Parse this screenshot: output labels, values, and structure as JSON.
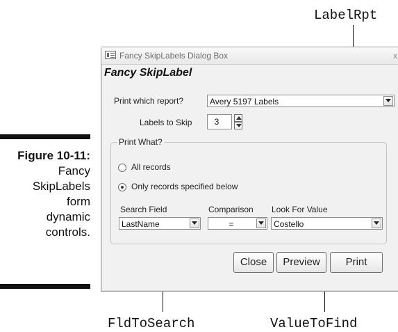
{
  "caption": {
    "figure_number": "Figure 10-11:",
    "lines": [
      "Fancy",
      "SkipLabels",
      "form",
      "dynamic",
      "controls."
    ]
  },
  "callouts": {
    "label_rpt": "LabelRpt",
    "fld_to_search": "FldToSearch",
    "value_to_find": "ValueToFind"
  },
  "window": {
    "title": "Fancy SkipLabels Dialog Box",
    "close_glyph": "x",
    "icon": "form-icon"
  },
  "form": {
    "heading": "Fancy SkipLabel",
    "print_which_report": {
      "label": "Print which report?",
      "value": "Avery 5197 Labels"
    },
    "labels_to_skip": {
      "label": "Labels to Skip",
      "value": "3"
    },
    "print_what": {
      "title": "Print What?",
      "options": [
        {
          "label": "All records",
          "selected": false
        },
        {
          "label": "Only records specified below",
          "selected": true
        }
      ]
    },
    "search_field": {
      "label": "Search Field",
      "value": "LastName"
    },
    "comparison": {
      "label": "Comparison",
      "value": "="
    },
    "look_for_value": {
      "label": "Look For Value",
      "value": "Costello"
    },
    "buttons": {
      "close": "Close",
      "preview": "Preview",
      "print": "Print"
    }
  }
}
